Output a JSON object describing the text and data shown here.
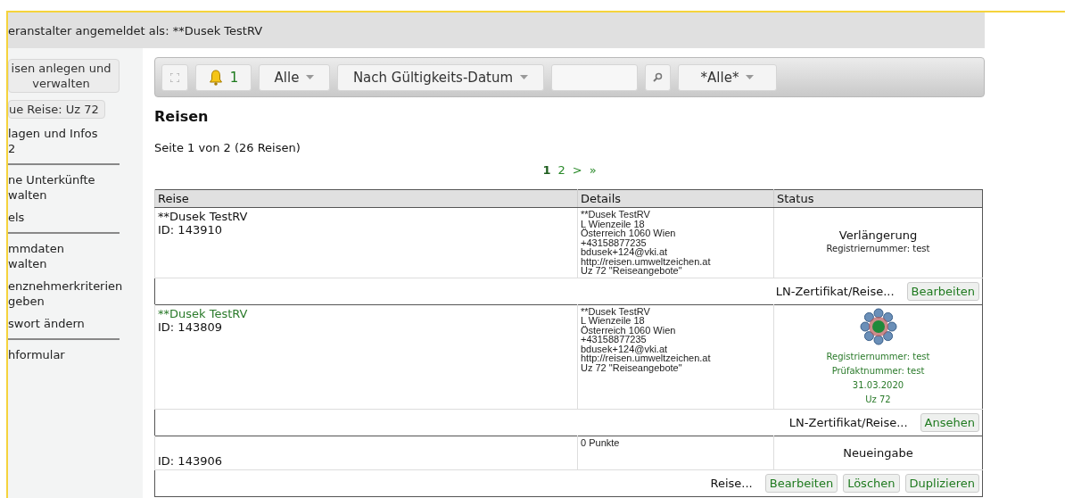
{
  "header": {
    "text": "eranstalter angemeldet als: **Dusek TestRV"
  },
  "sidebar": {
    "items": [
      {
        "kind": "button",
        "label": "isen anlegen und verwalten"
      },
      {
        "kind": "button",
        "label": "ue Reise: Uz 72"
      },
      {
        "kind": "link",
        "label": "lagen und Infos\n2"
      },
      {
        "kind": "divider"
      },
      {
        "kind": "link",
        "label": "ne Unterkünfte\nwalten"
      },
      {
        "kind": "link",
        "label": "els"
      },
      {
        "kind": "divider"
      },
      {
        "kind": "link",
        "label": "mmdaten\nwalten"
      },
      {
        "kind": "link",
        "label": "enznehmerkriterien\ngeben"
      },
      {
        "kind": "link",
        "label": "swort ändern"
      },
      {
        "kind": "divider"
      },
      {
        "kind": "link",
        "label": "hformular"
      }
    ]
  },
  "toolbar": {
    "notifications": "1",
    "filter": "Alle",
    "sort": "Nach Gültigkeits-Datum",
    "category": "*Alle*"
  },
  "title": "Reisen",
  "page_info": "Seite 1 von 2 (26 Reisen)",
  "pagination": [
    {
      "label": "1",
      "selected": true
    },
    {
      "label": "2",
      "selected": false
    },
    {
      "label": ">",
      "selected": false
    },
    {
      "label": "»",
      "selected": false
    }
  ],
  "table": {
    "columns": [
      "Reise",
      "Details",
      "Status"
    ],
    "rows": [
      {
        "name": "**Dusek TestRV",
        "highlighted": false,
        "id": "ID: 143910",
        "details": [
          "**Dusek TestRV",
          "L Wienzeile 18",
          "Österreich 1060 Wien",
          "+43158877235",
          "bdusek+124@vki.at",
          "http://reisen.umweltzeichen.at",
          "Uz 72 \"Reiseangebote\""
        ],
        "status": {
          "kind": "plain",
          "title": "Verlängerung",
          "lines": [
            "Registriernummer: test"
          ]
        },
        "action_label": "LN-Zertifikat/Reise...",
        "buttons": [
          "Bearbeiten"
        ]
      },
      {
        "name": "**Dusek TestRV",
        "highlighted": true,
        "id": "ID: 143809",
        "details": [
          "**Dusek TestRV",
          "L Wienzeile 18",
          "Österreich 1060 Wien",
          "+43158877235",
          "bdusek+124@vki.at",
          "http://reisen.umweltzeichen.at",
          "Uz 72 \"Reiseangebote\""
        ],
        "status": {
          "kind": "certified",
          "lines": [
            "Registriernummer: test",
            "Prüfaktnummer: test",
            "31.03.2020",
            "Uz 72"
          ]
        },
        "action_label": "LN-Zertifikat/Reise...",
        "buttons": [
          "Ansehen"
        ]
      },
      {
        "id": "ID: 143906",
        "details": [
          "0 Punkte"
        ],
        "status": {
          "kind": "plain",
          "title": "Neueingabe"
        },
        "action_label": "Reise...",
        "buttons": [
          "Bearbeiten",
          "Löschen",
          "Duplizieren"
        ]
      }
    ]
  }
}
